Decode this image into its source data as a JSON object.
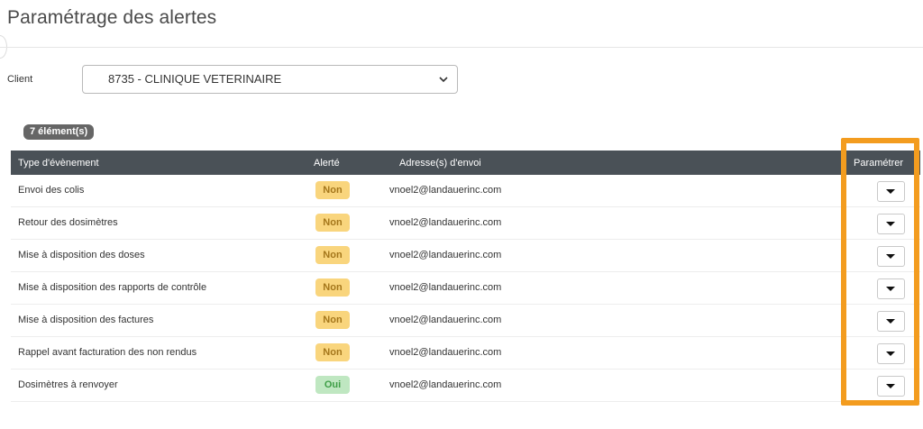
{
  "page": {
    "title": "Paramétrage des alertes"
  },
  "client": {
    "label": "Client",
    "selected": "8735 - CLINIQUE VETERINAIRE"
  },
  "grid": {
    "count_badge": "7 élément(s)",
    "columns": {
      "type": "Type d'évènement",
      "alert": "Alerté",
      "address": "Adresse(s) d'envoi",
      "param": "Paramétrer"
    },
    "rows": [
      {
        "type": "Envoi des colis",
        "alert": "Non",
        "address": "vnoel2@landauerinc.com"
      },
      {
        "type": "Retour des dosimètres",
        "alert": "Non",
        "address": "vnoel2@landauerinc.com"
      },
      {
        "type": "Mise à disposition des doses",
        "alert": "Non",
        "address": "vnoel2@landauerinc.com"
      },
      {
        "type": "Mise à disposition des rapports de contrôle",
        "alert": "Non",
        "address": "vnoel2@landauerinc.com"
      },
      {
        "type": "Mise à disposition des factures",
        "alert": "Non",
        "address": "vnoel2@landauerinc.com"
      },
      {
        "type": "Rappel avant facturation des non rendus",
        "alert": "Non",
        "address": "vnoel2@landauerinc.com"
      },
      {
        "type": "Dosimètres à renvoyer",
        "alert": "Oui",
        "address": "vnoel2@landauerinc.com"
      }
    ]
  },
  "colors": {
    "header_bg": "#4a5157",
    "pill_non_bg": "#f9d57d",
    "pill_oui_bg": "#bfe7c1",
    "highlight": "#f39c1f"
  }
}
